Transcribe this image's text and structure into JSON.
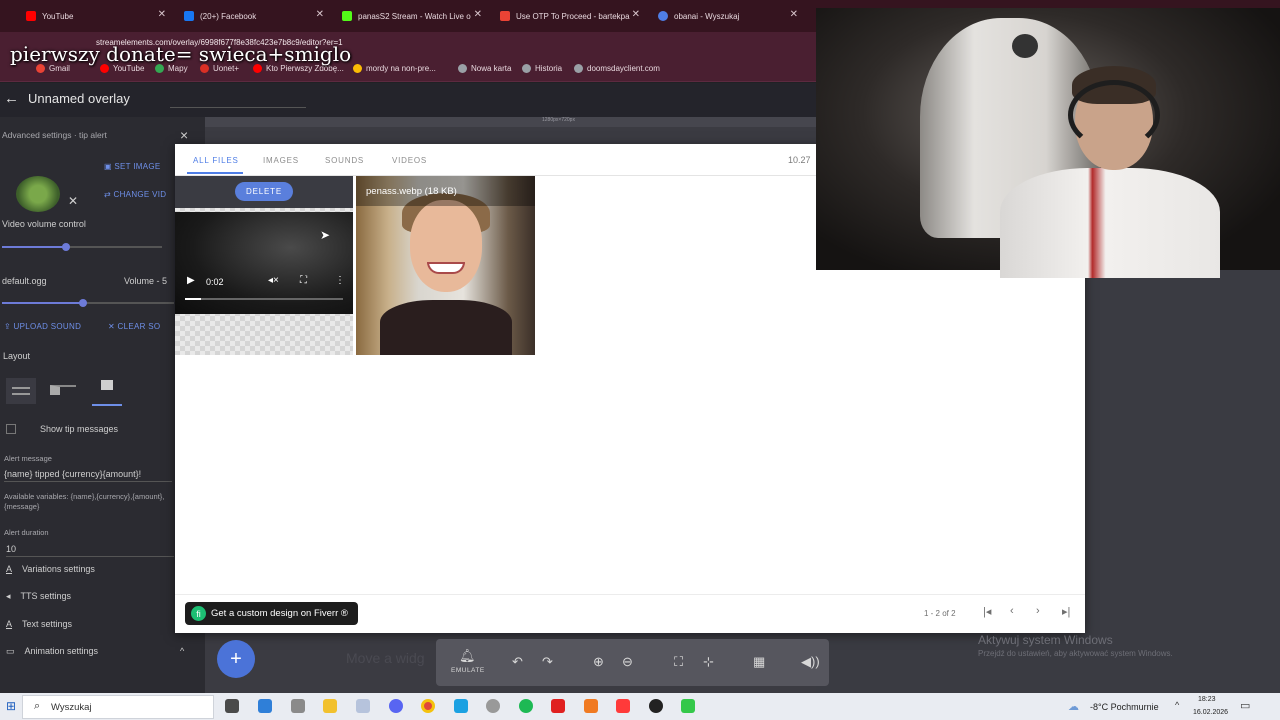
{
  "overlay_caption": "pierwszy donate= swieca+smiglo",
  "browser": {
    "tabs": [
      {
        "title": "YouTube",
        "color": "#ff0000"
      },
      {
        "title": "(20+) Facebook",
        "color": "#1877f2"
      },
      {
        "title": "panasS2 Stream - Watch Live o",
        "color": "#53fc18"
      },
      {
        "title": "Use OTP To Proceed - bartekpa",
        "color": "#ea4335"
      },
      {
        "title": "obanai - Wyszukaj",
        "color": "#4f7ee6"
      }
    ],
    "url": "streamelements.com/overlay/6998f677f8e38fc423e7b8c9/editor?er=1",
    "bookmarks": [
      {
        "label": "Gmail",
        "color": "#ea4335"
      },
      {
        "label": "YouTube",
        "color": "#ff0000"
      },
      {
        "label": "Mapy",
        "color": "#34a853"
      },
      {
        "label": "Uonet+",
        "color": "#d93025"
      },
      {
        "label": "Kto Pierwszy Zdobę...",
        "color": "#ff0000"
      },
      {
        "label": "mordy na non-pre...",
        "color": "#fbbc05"
      },
      {
        "label": "Nowa karta",
        "color": "#9aa0a6"
      },
      {
        "label": "Historia",
        "color": "#9aa0a6"
      },
      {
        "label": "doomsdayclient.com",
        "color": "#9aa0a6"
      }
    ]
  },
  "app": {
    "back_icon": "←",
    "title": "Unnamed overlay",
    "ruler_label": "1280px×720px"
  },
  "left_panel": {
    "advanced_title": "Advanced settings · tip alert",
    "close_icon": "×",
    "set_image": "SET IMAGE",
    "change_video": "CHANGE VID",
    "video_volume": "Video volume control",
    "video_volume_level": 0.4,
    "sound_file": "default.ogg",
    "volume_label": "Volume - 5",
    "sound_volume_level": 0.47,
    "upload_sound": "UPLOAD SOUND",
    "clear_sound": "CLEAR SO",
    "layout_label": "Layout",
    "show_tip": "Show tip messages",
    "alert_message_label": "Alert message",
    "alert_message_value": "{name} tipped {currency}{amount}!",
    "available_vars": "Available variables: {name},{currency},{amount},{message}",
    "alert_duration_label": "Alert duration",
    "alert_duration_value": "10",
    "variations": "Variations settings",
    "tts": "TTS settings",
    "text_settings": "Text settings",
    "animation": "Animation settings",
    "chevron": "^"
  },
  "modal": {
    "tabs": [
      "ALL FILES",
      "IMAGES",
      "SOUNDS",
      "VIDEOS"
    ],
    "active_tab": "ALL FILES",
    "counter": "10.27",
    "delete": "DELETE",
    "video_time": "0:02",
    "video_progress": 0.1,
    "file2_name": "penass.webp (18 KB)",
    "pagination": "1 - 2 of 2",
    "fiverr": "Get a custom design on Fiverr ®",
    "fiverr_icon": "fi"
  },
  "toolbar": {
    "add": "+",
    "move_widget": "Move a widg",
    "emulate": "EMULATE",
    "icons": [
      "bell-icon",
      "undo-icon",
      "redo-icon",
      "zoom-in-icon",
      "zoom-out-icon",
      "fullscreen-icon",
      "collapse-icon",
      "grid-icon",
      "volume-icon"
    ]
  },
  "windows_watermark": {
    "line1": "Aktywuj system Windows",
    "line2": "Przejdź do ustawień, aby aktywować system Windows."
  },
  "taskbar": {
    "search_placeholder": "Wyszukaj",
    "weather": "-8°C  Pochmurnie",
    "time": "18:23",
    "date": "16.02.2026"
  }
}
